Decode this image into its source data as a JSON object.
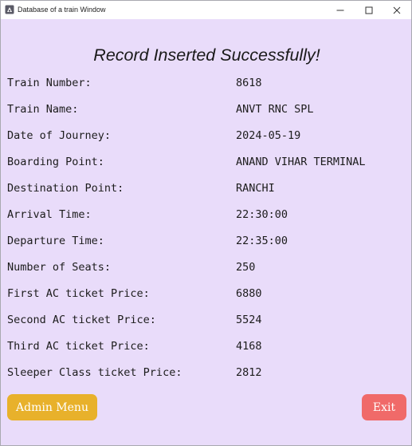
{
  "window": {
    "title": "Database of a train Window"
  },
  "heading": "Record Inserted Successfully!",
  "fields": [
    {
      "label": "Train Number:",
      "value": "8618"
    },
    {
      "label": "Train Name:",
      "value": "ANVT RNC SPL"
    },
    {
      "label": "Date of Journey:",
      "value": "2024-05-19"
    },
    {
      "label": "Boarding Point:",
      "value": "ANAND VIHAR TERMINAL"
    },
    {
      "label": "Destination Point:",
      "value": "RANCHI"
    },
    {
      "label": "Arrival Time:",
      "value": "22:30:00"
    },
    {
      "label": "Departure Time:",
      "value": "22:35:00"
    },
    {
      "label": "Number of Seats:",
      "value": "250"
    },
    {
      "label": "First AC ticket Price:",
      "value": "6880"
    },
    {
      "label": "Second AC ticket Price:",
      "value": "5524"
    },
    {
      "label": "Third AC ticket Price:",
      "value": "4168"
    },
    {
      "label": "Sleeper Class ticket Price:",
      "value": "2812"
    }
  ],
  "buttons": {
    "admin_menu": "Admin Menu",
    "exit": "Exit"
  },
  "colors": {
    "background": "#e9dcfa",
    "admin_button": "#e8b12b",
    "exit_button": "#f06a69"
  }
}
